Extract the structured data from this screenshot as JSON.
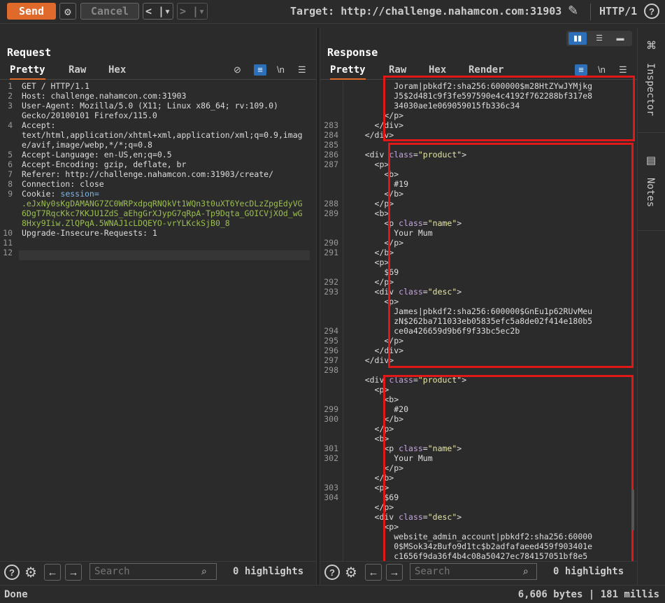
{
  "toolbar": {
    "send_label": "Send",
    "cancel_label": "Cancel",
    "back_label": "< |▾",
    "forward_label": "> |▾",
    "target_label": "Target: http://challenge.nahamcon.com:31903",
    "protocol_label": "HTTP/1",
    "help_label": "?"
  },
  "request": {
    "title": "Request",
    "tabs": [
      "Pretty",
      "Raw",
      "Hex"
    ],
    "line_numbers": [
      "1",
      "2",
      "3",
      "",
      "4",
      "",
      "",
      "5",
      "6",
      "7",
      "8",
      "9",
      "",
      "",
      "",
      "10",
      "11",
      "12"
    ],
    "lines": [
      "GET / HTTP/1.1",
      "Host: challenge.nahamcon.com:31903",
      "User-Agent: Mozilla/5.0 (X11; Linux x86_64; rv:109.0)",
      "Gecko/20100101 Firefox/115.0",
      "Accept:",
      "text/html,application/xhtml+xml,application/xml;q=0.9,imag",
      "e/avif,image/webp,*/*;q=0.8",
      "Accept-Language: en-US,en;q=0.5",
      "Accept-Encoding: gzip, deflate, br",
      "Referer: http://challenge.nahamcon.com:31903/create/",
      "Connection: close",
      "Cookie: session=",
      ".eJxNy0sKgDAMANG7ZC0WRPxdpqRNQkVt1WQn3t0uXT6YecDLzZpgEdyVG",
      "6DgT7RqcKkc7KKJU1ZdS_aEhgGrXJypG7qRpA-Tp9Dqta_GOICVjXOd_wG",
      "8Hxy9Iiw.ZlQPqA.5WNAJ1cLDQEYO-vrYLKckSjB0_8",
      "Upgrade-Insecure-Requests: 1",
      "",
      ""
    ]
  },
  "response": {
    "title": "Response",
    "tabs": [
      "Pretty",
      "Raw",
      "Hex",
      "Render"
    ],
    "line_numbers": [
      "",
      "",
      "",
      "",
      "283",
      "284",
      "285",
      "286",
      "287",
      "",
      "",
      "",
      "288",
      "289",
      "",
      "",
      "290",
      "291",
      "",
      "",
      "292",
      "293",
      "",
      "",
      "",
      "294",
      "295",
      "296",
      "297",
      "298",
      "",
      "",
      "",
      "299",
      "300",
      "",
      "",
      "301",
      "302",
      "",
      "",
      "303",
      "304",
      "",
      ""
    ],
    "lines": [
      "          Joram|pbkdf2:sha256:600000$m28HtZYwJYMjkg",
      "          J5$2d481c9f3fe597590e4c4192f762288bf317e8",
      "          34030ae1e069059015fb336c34",
      "        </p>",
      "      </div>",
      "    </div>",
      "",
      "    <div class=\"product\">",
      "      <p>",
      "        <b>",
      "          #19",
      "        </b>",
      "      </p>",
      "      <b>",
      "        <p class=\"name\">",
      "          Your Mum",
      "        </p>",
      "      </b>",
      "      <p>",
      "        $69",
      "      </p>",
      "      <div class=\"desc\">",
      "        <p>",
      "          James|pbkdf2:sha256:600000$GnEu1p62RUvMeu",
      "          zN$262ba711033eb05835efc5a8de02f414e180b5",
      "          ce0a426659d9b6f9f33bc5ec2b",
      "        </p>",
      "      </div>",
      "    </div>",
      "",
      "    <div class=\"product\">",
      "      <p>",
      "        <b>",
      "          #20",
      "        </b>",
      "      </p>",
      "      <b>",
      "        <p class=\"name\">",
      "          Your Mum",
      "        </p>",
      "      </b>",
      "      <p>",
      "        $69",
      "      </p>",
      "      <div class=\"desc\">",
      "        <p>",
      "          website_admin_account|pbkdf2:sha256:60000",
      "          0$MSok34zBufo9d1tc$b2adfafaeed459f903401e",
      "          c1656f9da36f4b4c08a50427ec784157051bf8e5"
    ]
  },
  "search": {
    "placeholder": "Search",
    "highlights_label": "0 highlights"
  },
  "sidebar": {
    "inspector_label": "Inspector",
    "notes_label": "Notes"
  },
  "status": {
    "left": "Done",
    "right": "6,606 bytes | 181 millis"
  },
  "colors": {
    "accent": "#e06a2c",
    "highlight_box": "#e01818",
    "active_icon": "#2d6fb8"
  }
}
